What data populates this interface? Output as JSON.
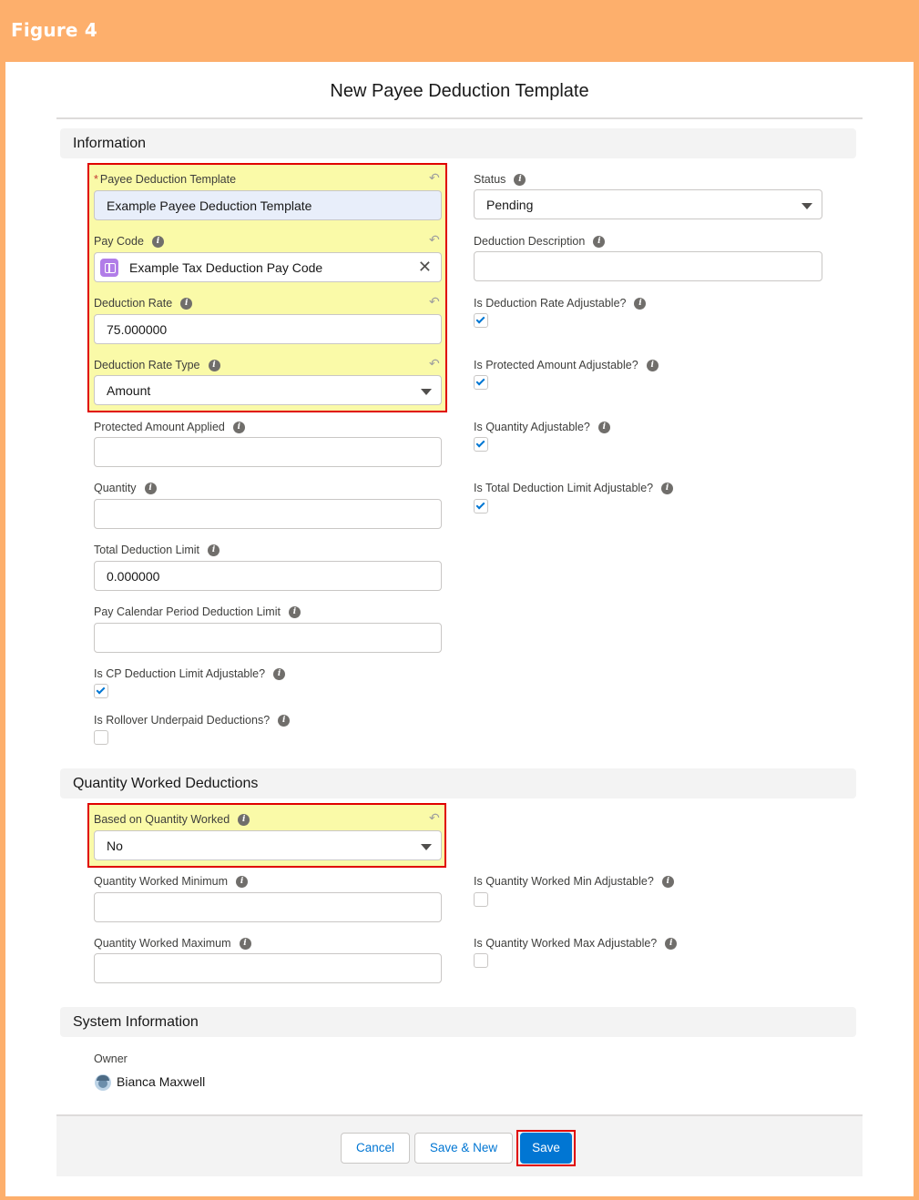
{
  "figure": {
    "title": "Figure 4"
  },
  "modal": {
    "title": "New Payee Deduction Template"
  },
  "sections": {
    "information": "Information",
    "quantity_worked": "Quantity Worked Deductions",
    "system": "System Information"
  },
  "left_fields": {
    "template": {
      "label": "Payee Deduction Template",
      "value": "Example Payee Deduction Template"
    },
    "pay_code": {
      "label": "Pay Code",
      "value": "Example Tax Deduction Pay Code"
    },
    "rate": {
      "label": "Deduction Rate",
      "value": "75.000000"
    },
    "rate_type": {
      "label": "Deduction Rate Type",
      "value": "Amount"
    },
    "protected": {
      "label": "Protected Amount Applied",
      "value": ""
    },
    "quantity": {
      "label": "Quantity",
      "value": ""
    },
    "total_limit": {
      "label": "Total Deduction Limit",
      "value": "0.000000"
    },
    "period_limit": {
      "label": "Pay Calendar Period Deduction Limit",
      "value": ""
    },
    "cp_adjustable": {
      "label": "Is CP Deduction Limit Adjustable?",
      "checked": true
    },
    "rollover": {
      "label": "Is Rollover Underpaid Deductions?",
      "checked": false
    }
  },
  "right_fields": {
    "status": {
      "label": "Status",
      "value": "Pending"
    },
    "description": {
      "label": "Deduction Description",
      "value": ""
    },
    "rate_adjustable": {
      "label": "Is Deduction Rate Adjustable?",
      "checked": true
    },
    "protected_adjustable": {
      "label": "Is Protected Amount Adjustable?",
      "checked": true
    },
    "quantity_adjustable": {
      "label": "Is Quantity Adjustable?",
      "checked": true
    },
    "total_limit_adjustable": {
      "label": "Is Total Deduction Limit Adjustable?",
      "checked": true
    }
  },
  "qw_fields": {
    "based_on": {
      "label": "Based on Quantity Worked",
      "value": "No"
    },
    "min": {
      "label": "Quantity Worked Minimum",
      "value": ""
    },
    "max": {
      "label": "Quantity Worked Maximum",
      "value": ""
    },
    "min_adjustable": {
      "label": "Is Quantity Worked Min Adjustable?",
      "checked": false
    },
    "max_adjustable": {
      "label": "Is Quantity Worked Max Adjustable?",
      "checked": false
    }
  },
  "system_fields": {
    "owner_label": "Owner",
    "owner_name": "Bianca Maxwell"
  },
  "footer": {
    "cancel": "Cancel",
    "save_new": "Save & New",
    "save": "Save"
  },
  "colors": {
    "brand": "#0176d3",
    "highlight": "#fafaa8",
    "callout": "#e00000",
    "frame": "#fdaf6c"
  }
}
